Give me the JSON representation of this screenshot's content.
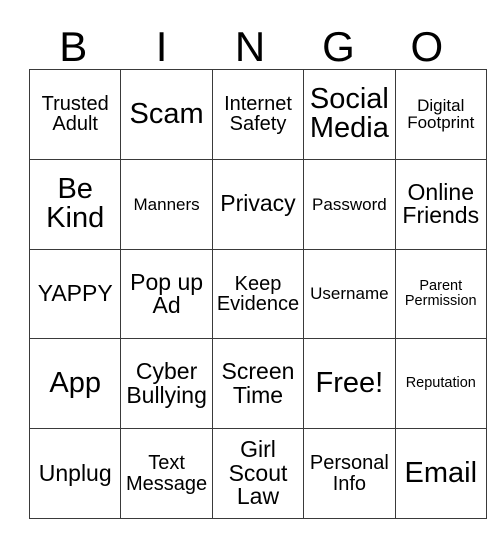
{
  "card": {
    "title_letters": [
      "B",
      "I",
      "N",
      "G",
      "O"
    ],
    "border_color": "#3a3a3a",
    "text_color": "#000000",
    "background_color": "#ffffff",
    "free_space_label": "Free!",
    "grid_size": "5x5",
    "rows": [
      [
        {
          "label": "Trusted Adult",
          "size": "md"
        },
        {
          "label": "Scam",
          "size": "xxl"
        },
        {
          "label": "Internet Safety",
          "size": "md"
        },
        {
          "label": "Social Media",
          "size": "xxl"
        },
        {
          "label": "Digital Footprint",
          "size": "sm"
        }
      ],
      [
        {
          "label": "Be Kind",
          "size": "xxl"
        },
        {
          "label": "Manners",
          "size": "sm"
        },
        {
          "label": "Privacy",
          "size": "lg"
        },
        {
          "label": "Password",
          "size": "sm"
        },
        {
          "label": "Online Friends",
          "size": "lg"
        }
      ],
      [
        {
          "label": "YAPPY",
          "size": "lg"
        },
        {
          "label": "Pop up Ad",
          "size": "lg"
        },
        {
          "label": "Keep Evidence",
          "size": "md"
        },
        {
          "label": "Username",
          "size": "sm"
        },
        {
          "label": "Parent Permission",
          "size": "xs"
        }
      ],
      [
        {
          "label": "App",
          "size": "xxl"
        },
        {
          "label": "Cyber Bullying",
          "size": "lg"
        },
        {
          "label": "Screen Time",
          "size": "lg"
        },
        {
          "label": "Free!",
          "size": "xxl"
        },
        {
          "label": "Reputation",
          "size": "xs"
        }
      ],
      [
        {
          "label": "Unplug",
          "size": "lg"
        },
        {
          "label": "Text Message",
          "size": "md"
        },
        {
          "label": "Girl Scout Law",
          "size": "lg"
        },
        {
          "label": "Personal Info",
          "size": "md"
        },
        {
          "label": "Email",
          "size": "xxl"
        }
      ]
    ]
  }
}
